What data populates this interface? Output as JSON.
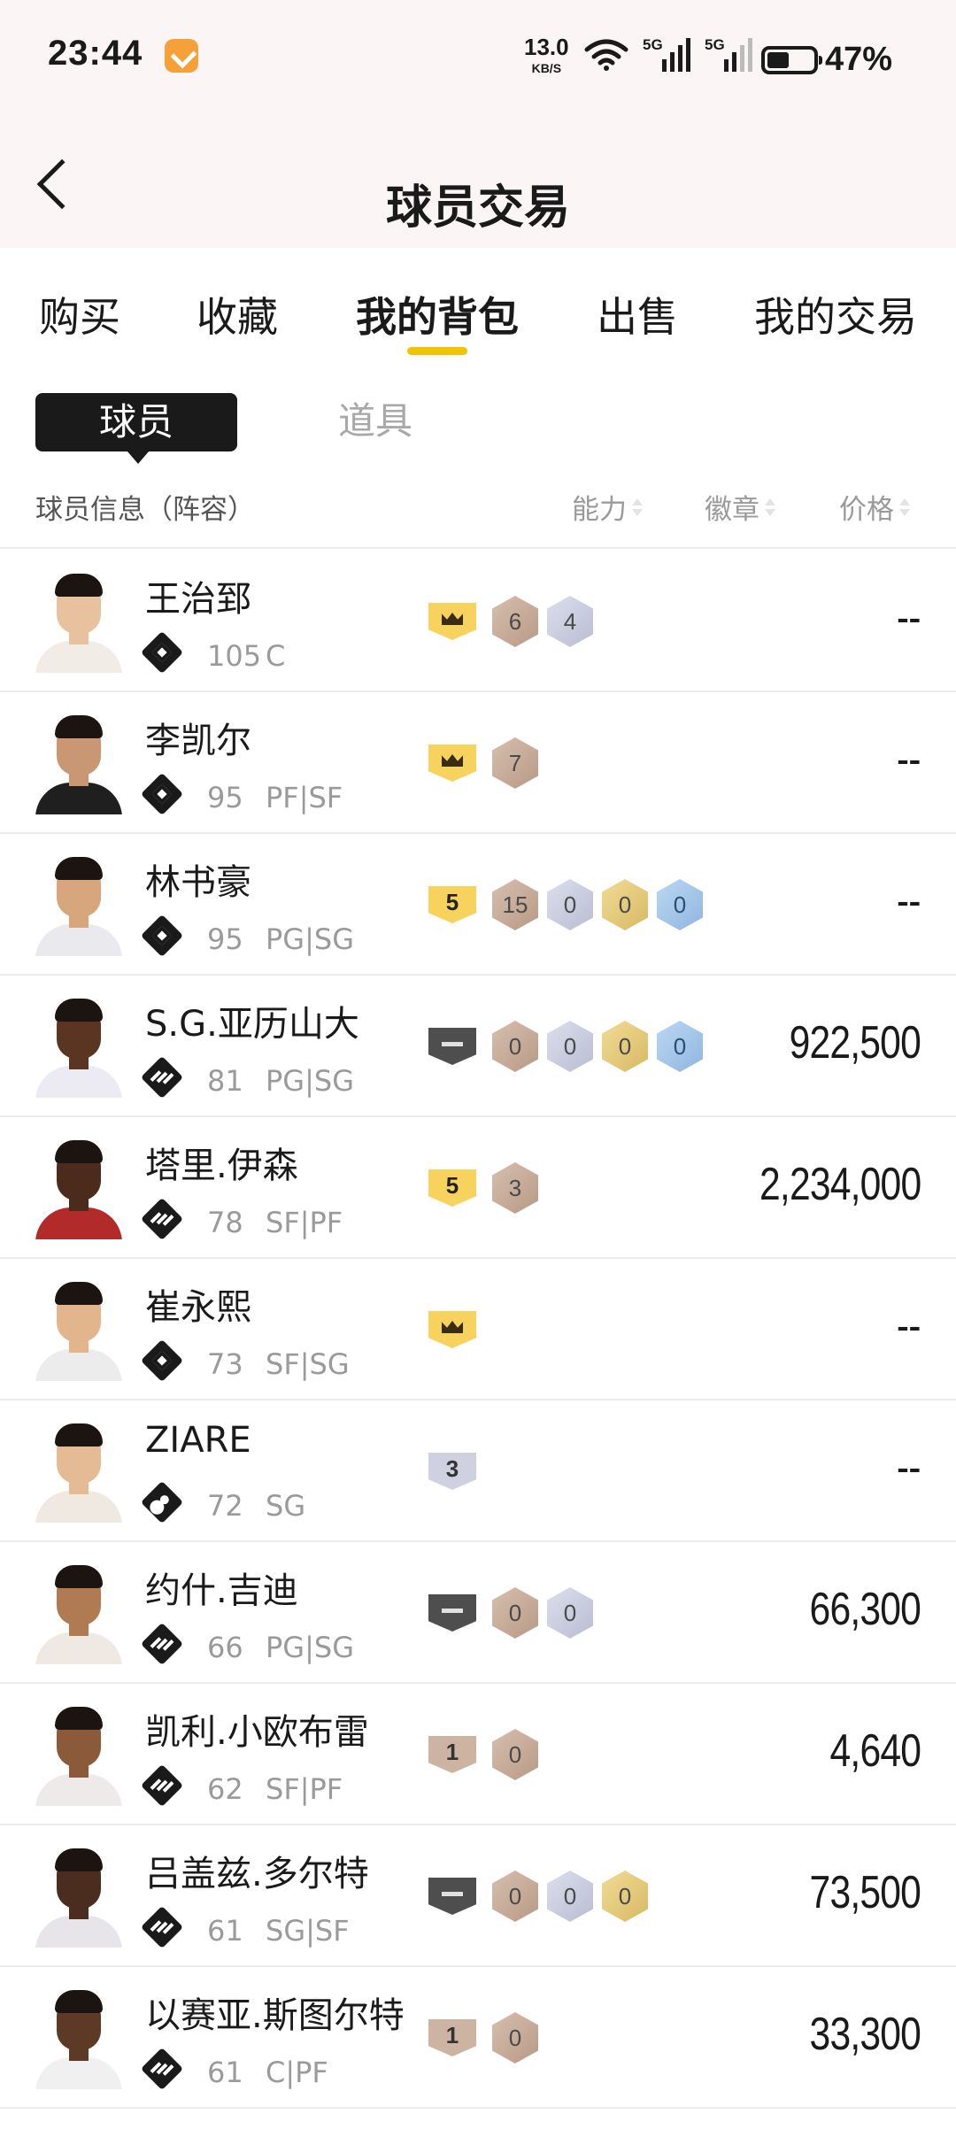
{
  "status": {
    "time": "23:44",
    "speed_value": "13.0",
    "speed_unit": "KB/S",
    "net1": "5G",
    "net2": "5G",
    "battery": "47%"
  },
  "header": {
    "title": "球员交易"
  },
  "tabs": [
    {
      "label": "购买",
      "active": false
    },
    {
      "label": "收藏",
      "active": false
    },
    {
      "label": "我的背包",
      "active": true
    },
    {
      "label": "出售",
      "active": false
    },
    {
      "label": "我的交易",
      "active": false
    }
  ],
  "subtabs": {
    "player": "球员",
    "prop": "道具"
  },
  "columns": {
    "info": "球员信息（阵容）",
    "ability": "能力",
    "badge": "徽章",
    "price": "价格"
  },
  "players": [
    {
      "name": "王治郅",
      "rating": "105",
      "pos": "C",
      "tier": "star",
      "skin": "#e8c29f",
      "shirt": "#f1ece6",
      "shield": {
        "type": "crown",
        "style": "gold"
      },
      "badges": [
        {
          "v": "6",
          "c": "bronze"
        },
        {
          "v": "4",
          "c": "silver"
        }
      ],
      "price": "--"
    },
    {
      "name": "李凯尔",
      "rating": "95",
      "pos": "PF|SF",
      "tier": "star",
      "skin": "#c99773",
      "shirt": "#1f1f1f",
      "shield": {
        "type": "crown",
        "style": "gold"
      },
      "badges": [
        {
          "v": "7",
          "c": "bronze"
        }
      ],
      "price": "--"
    },
    {
      "name": "林书豪",
      "rating": "95",
      "pos": "PG|SG",
      "tier": "star",
      "skin": "#d8a67c",
      "shirt": "#e9e9ee",
      "shield": {
        "type": "num",
        "value": "5",
        "style": "gold"
      },
      "badges": [
        {
          "v": "15",
          "c": "bronze"
        },
        {
          "v": "0",
          "c": "silver"
        },
        {
          "v": "0",
          "c": "gold"
        },
        {
          "v": "0",
          "c": "blue"
        }
      ],
      "price": "--"
    },
    {
      "name": "S.G.亚历山大",
      "rating": "81",
      "pos": "PG|SG",
      "tier": "bars",
      "skin": "#5a3522",
      "shirt": "#eceaf2",
      "shield": {
        "type": "dash",
        "style": "gray"
      },
      "badges": [
        {
          "v": "0",
          "c": "bronze"
        },
        {
          "v": "0",
          "c": "silver"
        },
        {
          "v": "0",
          "c": "gold"
        },
        {
          "v": "0",
          "c": "blue"
        }
      ],
      "price": "922,500"
    },
    {
      "name": "塔里.伊森",
      "rating": "78",
      "pos": "SF|PF",
      "tier": "bars",
      "skin": "#4a2b1c",
      "shirt": "#b32a2a",
      "shield": {
        "type": "num",
        "value": "5",
        "style": "gold"
      },
      "badges": [
        {
          "v": "3",
          "c": "bronze"
        }
      ],
      "price": "2,234,000"
    },
    {
      "name": "崔永熙",
      "rating": "73",
      "pos": "SF|SG",
      "tier": "star",
      "skin": "#e3b58c",
      "shirt": "#ececec",
      "shield": {
        "type": "crown",
        "style": "gold"
      },
      "badges": [],
      "price": "--"
    },
    {
      "name": "ZIARE",
      "rating": "72",
      "pos": "SG",
      "tier": "person",
      "skin": "#e5bb96",
      "shirt": "#efe9e2",
      "shield": {
        "type": "num",
        "value": "3",
        "style": "light"
      },
      "badges": [],
      "price": "--"
    },
    {
      "name": "约什.吉迪",
      "rating": "66",
      "pos": "PG|SG",
      "tier": "bars",
      "skin": "#b07a52",
      "shirt": "#efe9e4",
      "shield": {
        "type": "dash",
        "style": "gray"
      },
      "badges": [
        {
          "v": "0",
          "c": "bronze"
        },
        {
          "v": "0",
          "c": "silver"
        }
      ],
      "price": "66,300"
    },
    {
      "name": "凯利.小欧布雷",
      "rating": "62",
      "pos": "SF|PF",
      "tier": "bars",
      "skin": "#8a5a3a",
      "shirt": "#efeaea",
      "shield": {
        "type": "num",
        "value": "1",
        "style": "tan"
      },
      "badges": [
        {
          "v": "0",
          "c": "bronze"
        }
      ],
      "price": "4,640"
    },
    {
      "name": "吕盖兹.多尔特",
      "rating": "61",
      "pos": "SG|SF",
      "tier": "bars",
      "skin": "#4a2d1e",
      "shirt": "#e7e4ea",
      "shield": {
        "type": "dash",
        "style": "gray"
      },
      "badges": [
        {
          "v": "0",
          "c": "bronze"
        },
        {
          "v": "0",
          "c": "silver"
        },
        {
          "v": "0",
          "c": "gold"
        }
      ],
      "price": "73,500"
    },
    {
      "name": "以赛亚.斯图尔特",
      "rating": "61",
      "pos": "C|PF",
      "tier": "bars",
      "skin": "#5c3a26",
      "shirt": "#f0f0f0",
      "shield": {
        "type": "num",
        "value": "1",
        "style": "tan"
      },
      "badges": [
        {
          "v": "0",
          "c": "bronze"
        }
      ],
      "price": "33,300"
    }
  ]
}
